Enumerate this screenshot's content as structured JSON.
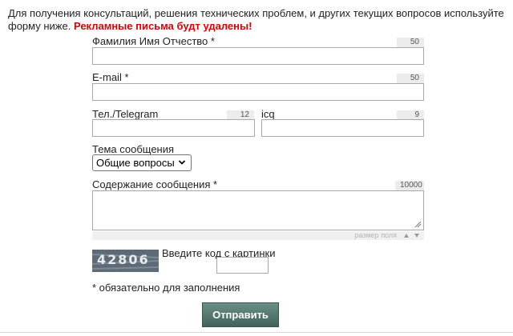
{
  "intro": {
    "text": "Для получения консультаций, решения технических проблем, и других текущих вопросов используйте форму ниже.",
    "warning": "Рекламные письма будт удалены!"
  },
  "fields": {
    "fio": {
      "label": "Фамилия Имя Отчество *",
      "counter": "50",
      "value": ""
    },
    "email": {
      "label": "E-mail *",
      "counter": "50",
      "value": ""
    },
    "phone": {
      "label": "Тел./Telegram",
      "counter": "12",
      "value": ""
    },
    "icq": {
      "label": "icq",
      "counter": "9",
      "value": ""
    }
  },
  "subject": {
    "label": "Тема сообщения",
    "selected": "Общие вопросы"
  },
  "message": {
    "label": "Содержание сообщения *",
    "counter": "10000",
    "value": "",
    "resize_label": "размер поля"
  },
  "captcha": {
    "image_code": "42806",
    "label": "Введите код с картинки",
    "value": ""
  },
  "required_note": "* обязательно для заполнения",
  "submit_label": "Отправить"
}
